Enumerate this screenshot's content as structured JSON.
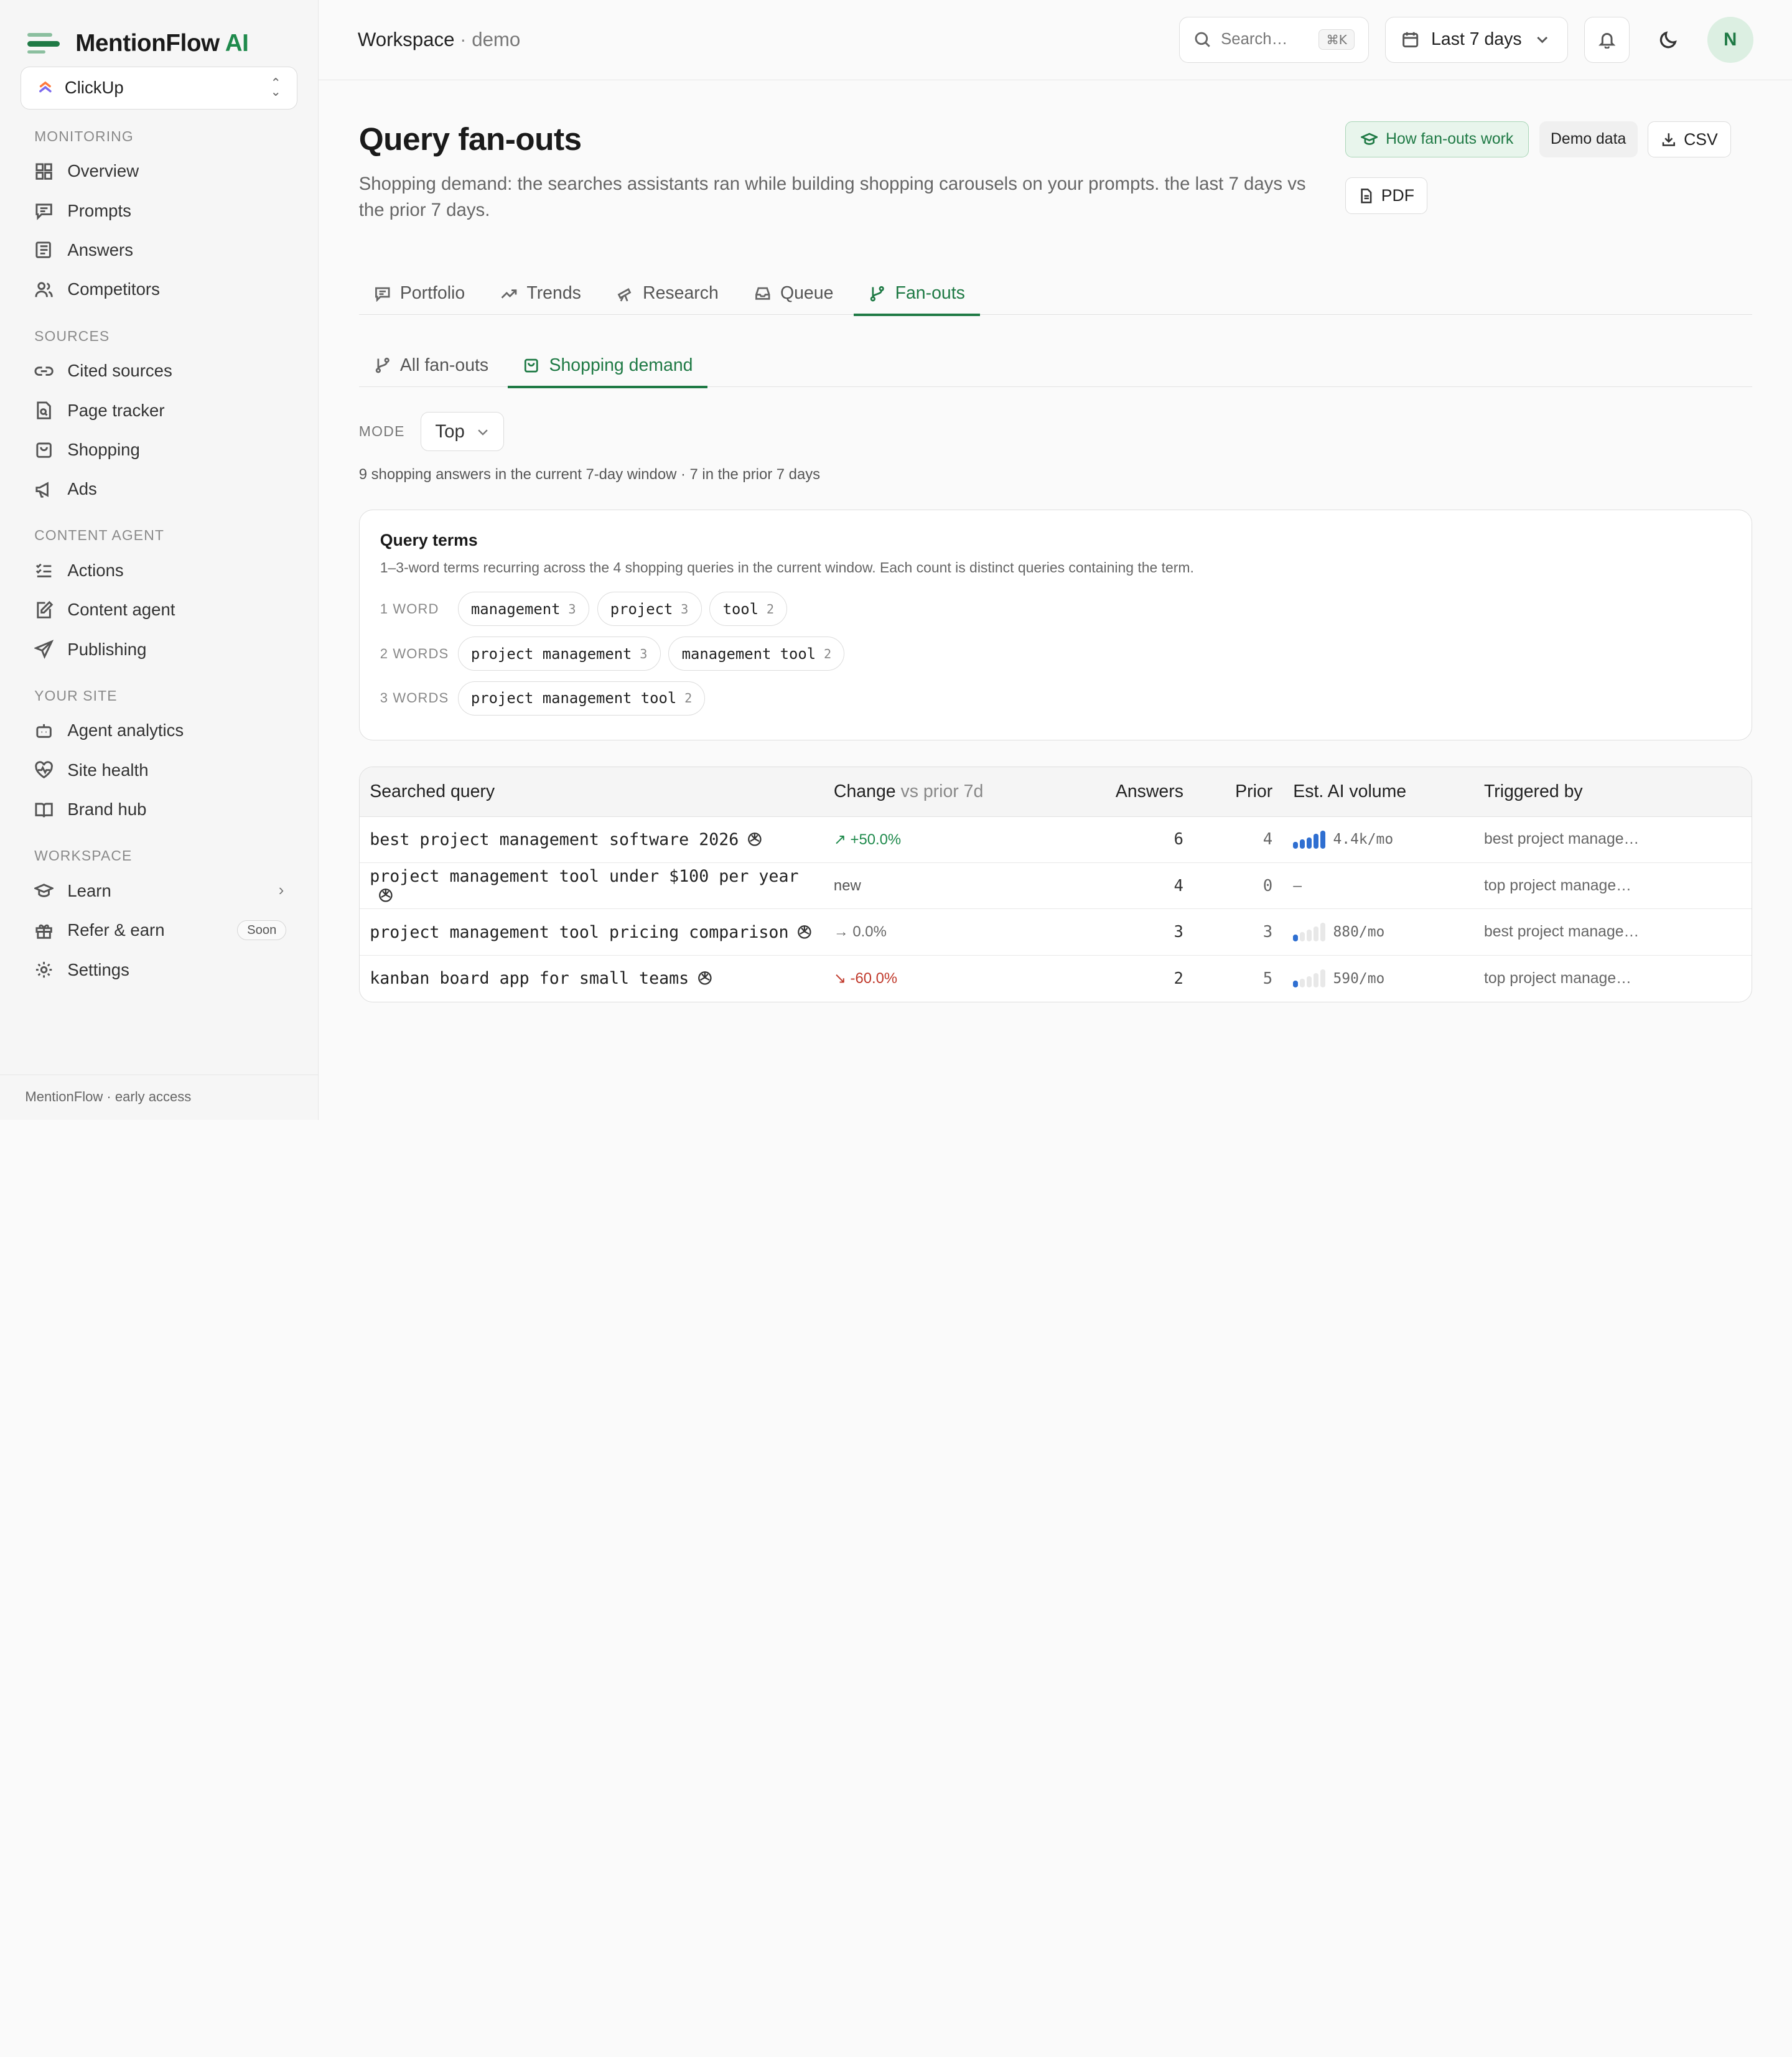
{
  "brand": {
    "name": "MentionFlow",
    "suffix": "AI"
  },
  "workspace_select": {
    "label": "ClickUp"
  },
  "nav": {
    "monitoring": {
      "title": "MONITORING",
      "items": [
        "Overview",
        "Prompts",
        "Answers",
        "Competitors"
      ]
    },
    "sources": {
      "title": "SOURCES",
      "items": [
        "Cited sources",
        "Page tracker",
        "Shopping",
        "Ads"
      ]
    },
    "content_agent": {
      "title": "CONTENT AGENT",
      "items": [
        "Actions",
        "Content agent",
        "Publishing"
      ]
    },
    "your_site": {
      "title": "YOUR SITE",
      "items": [
        "Agent analytics",
        "Site health",
        "Brand hub"
      ]
    },
    "workspace": {
      "title": "WORKSPACE",
      "items": [
        "Learn",
        "Refer & earn",
        "Settings"
      ],
      "soon_badge": "Soon"
    }
  },
  "sidebar_footer": "MentionFlow · early access",
  "topbar": {
    "crumb_main": "Workspace",
    "crumb_sep": " · ",
    "crumb_sub": "demo",
    "search_placeholder": "Search…",
    "search_kbd": "⌘K",
    "date_range": "Last 7 days",
    "avatar_initial": "N"
  },
  "page": {
    "title": "Query fan-outs",
    "description": "Shopping demand: the searches assistants ran while building shopping carousels on your prompts. the last 7 days vs the prior 7 days.",
    "actions": {
      "how": "How fan-outs work",
      "demo": "Demo data",
      "csv": "CSV",
      "pdf": "PDF"
    }
  },
  "tabs": [
    "Portfolio",
    "Trends",
    "Research",
    "Queue",
    "Fan-outs"
  ],
  "subtabs": [
    "All fan-outs",
    "Shopping demand"
  ],
  "mode": {
    "label": "MODE",
    "value": "Top"
  },
  "summary": "9 shopping answers in the current 7-day window · 7 in the prior 7 days",
  "query_terms": {
    "title": "Query terms",
    "description": "1–3-word terms recurring across the 4 shopping queries in the current window. Each count is distinct queries containing the term.",
    "rows": [
      {
        "label": "1 WORD",
        "terms": [
          {
            "term": "management",
            "count": "3"
          },
          {
            "term": "project",
            "count": "3"
          },
          {
            "term": "tool",
            "count": "2"
          }
        ]
      },
      {
        "label": "2 WORDS",
        "terms": [
          {
            "term": "project management",
            "count": "3"
          },
          {
            "term": "management tool",
            "count": "2"
          }
        ]
      },
      {
        "label": "3 WORDS",
        "terms": [
          {
            "term": "project management tool",
            "count": "2"
          }
        ]
      }
    ]
  },
  "table": {
    "headers": {
      "query": "Searched query",
      "change": "Change",
      "change_sub": "vs prior 7d",
      "answers": "Answers",
      "prior": "Prior",
      "volume": "Est. AI volume",
      "triggered": "Triggered by"
    },
    "rows": [
      {
        "query": "best project management software 2026",
        "change": "↗ +50.0%",
        "change_dir": "up",
        "answers": "6",
        "prior": "4",
        "volume": "4.4k/mo",
        "volume_level": 5,
        "triggered": "best project manage…"
      },
      {
        "query": "project management tool under $100 per year",
        "change": "new",
        "change_dir": "new",
        "answers": "4",
        "prior": "0",
        "volume": "—",
        "volume_level": 0,
        "triggered": "top project manage…"
      },
      {
        "query": "project management tool pricing comparison",
        "change": "→ 0.0%",
        "change_dir": "flat",
        "answers": "3",
        "prior": "3",
        "volume": "880/mo",
        "volume_level": 1,
        "triggered": "best project manage…"
      },
      {
        "query": "kanban board app for small teams",
        "change": "↘ -60.0%",
        "change_dir": "down",
        "answers": "2",
        "prior": "5",
        "volume": "590/mo",
        "volume_level": 1,
        "triggered": "top project manage…"
      }
    ]
  },
  "colors": {
    "accent": "#1f7a45",
    "bar_on": "#2f6fd1",
    "up": "#1f8a4c",
    "down": "#c0392b"
  }
}
